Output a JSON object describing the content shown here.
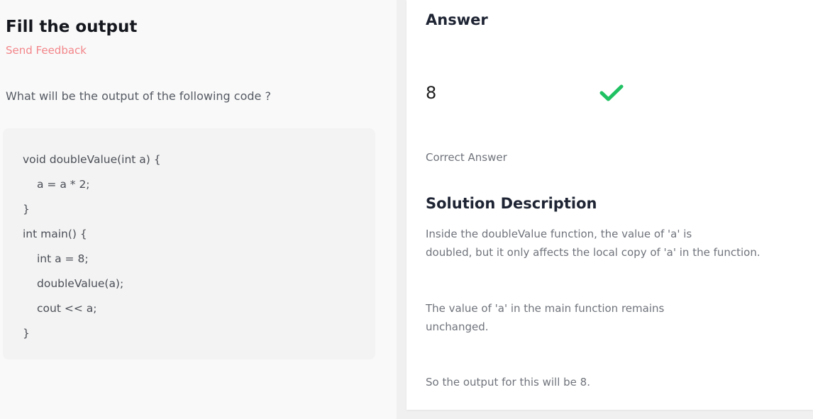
{
  "question_panel": {
    "title": "Fill the output",
    "feedback_link": "Send Feedback",
    "question": "What will be the output of the following code ?",
    "code_lines": [
      "void doubleValue(int a) {",
      "a = a * 2;",
      "}",
      "int main() {",
      "int a = 8;",
      "doubleValue(a);",
      "cout << a;",
      "}"
    ]
  },
  "answer_panel": {
    "heading": "Answer",
    "value": "8",
    "status_icon": "check-icon",
    "status_color": "#1fc162",
    "status_label": "Correct Answer",
    "solution_heading": "Solution Description",
    "paragraphs": [
      [
        "Inside the doubleValue function, the value of 'a' is",
        "doubled, but it only affects the local copy of 'a' in the function."
      ],
      [
        "The value of 'a' in the main function remains",
        "unchanged."
      ],
      [
        "So the output for this will be 8."
      ]
    ]
  }
}
